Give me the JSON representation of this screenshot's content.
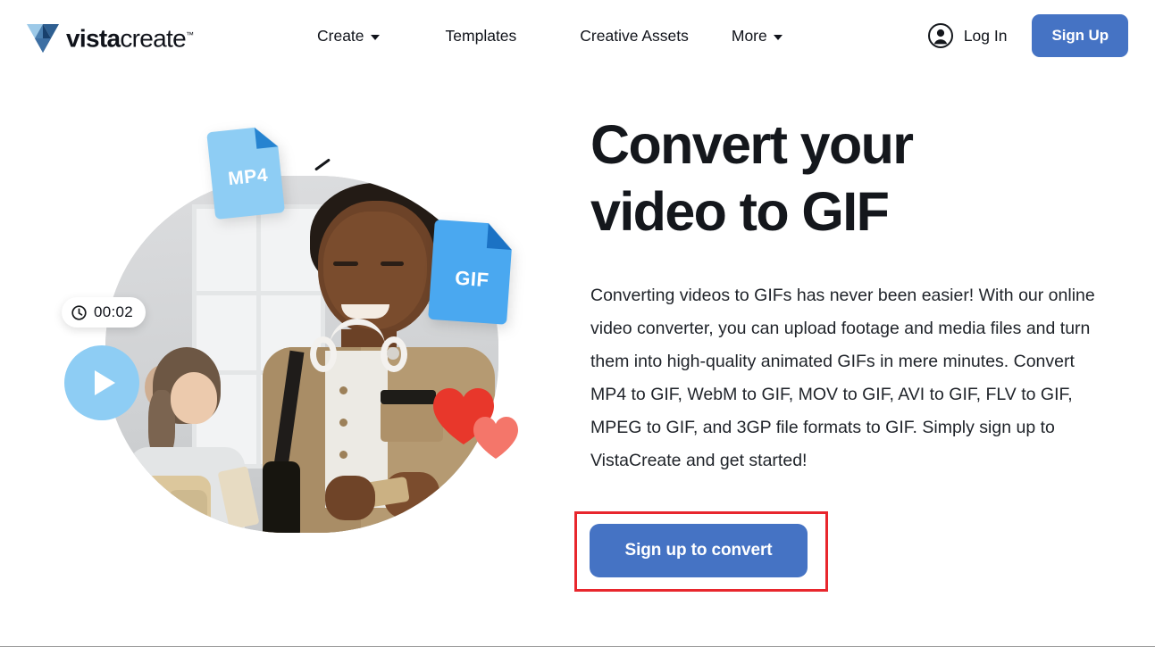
{
  "header": {
    "logo": {
      "name": "vistacreate-logo",
      "word_bold": "vista",
      "word_light": "create",
      "trademark": "™"
    },
    "nav": [
      {
        "label": "Create",
        "has_dropdown": true,
        "icon": "chevron-down-icon"
      },
      {
        "label": "Templates",
        "has_dropdown": false
      },
      {
        "label": "Creative Assets",
        "has_dropdown": false
      },
      {
        "label": "More",
        "has_dropdown": true,
        "icon": "chevron-down-icon"
      }
    ],
    "auth": {
      "login_label": "Log In",
      "login_icon": "user-avatar-icon",
      "signup_label": "Sign Up"
    }
  },
  "hero": {
    "title_line1": "Convert your",
    "title_line2": "video to GIF",
    "paragraph": "Converting videos to GIFs has never been easier! With our online video converter, you can upload footage and media files and turn them into high-quality animated GIFs in mere minutes. Convert MP4 to GIF, WebM to GIF, MOV to GIF, AVI to GIF, FLV to GIF, MPEG to GIF, and 3GP file formats to GIF. Simply sign up to VistaCreate and get started!",
    "cta_label": "Sign up to convert",
    "visual": {
      "badge_mp4": "MP4",
      "badge_gif": "GIF",
      "timer_value": "00:02",
      "timer_icon": "clock-icon",
      "play_icon": "play-triangle-icon",
      "heart_icon": "heart-icon",
      "photo_alt": "young-man-with-headphones-looking-at-phone"
    }
  },
  "colors": {
    "brand_blue": "#4573c4",
    "badge_mp4_blue": "#8ecdf4",
    "badge_mp4_fold": "#2683d0",
    "badge_gif_blue": "#4aa8f0",
    "badge_gif_fold": "#1b72c4",
    "play_circle": "#8ecdf4",
    "heart_red": "#e8372b",
    "heart_coral": "#f4766a",
    "annotation_red": "#e8262d",
    "text_dark": "#14171c"
  }
}
